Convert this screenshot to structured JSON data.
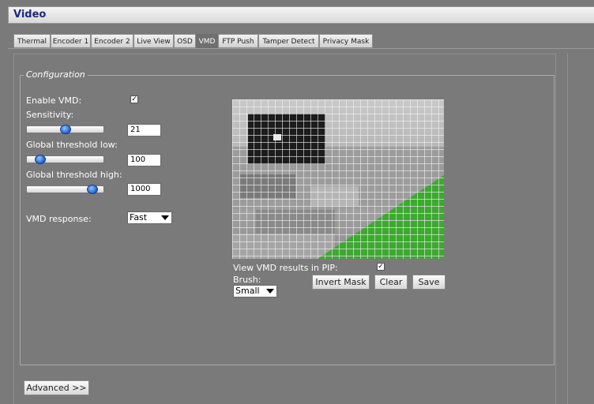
{
  "title": "Video",
  "tabs": [
    {
      "label": "Thermal",
      "active": false
    },
    {
      "label": "Encoder 1",
      "active": false
    },
    {
      "label": "Encoder 2",
      "active": false
    },
    {
      "label": "Live View",
      "active": false
    },
    {
      "label": "OSD",
      "active": false
    },
    {
      "label": "VMD",
      "active": true
    },
    {
      "label": "FTP Push",
      "active": false
    },
    {
      "label": "Tamper Detect",
      "active": false
    },
    {
      "label": "Privacy Mask",
      "active": false
    }
  ],
  "configuration": {
    "legend": "Configuration",
    "enable_vmd": {
      "label": "Enable VMD:",
      "checked": true
    },
    "sensitivity": {
      "label": "Sensitivity:",
      "value": "21",
      "slider_fraction": 0.5
    },
    "threshold_low": {
      "label": "Global threshold low:",
      "value": "100",
      "slider_fraction": 0.12
    },
    "threshold_high": {
      "label": "Global threshold high:",
      "value": "1000",
      "slider_fraction": 0.92
    },
    "vmd_response": {
      "label": "VMD response:",
      "selected": "Fast"
    }
  },
  "pip": {
    "label": "View VMD results in PIP:",
    "checked": true
  },
  "brush": {
    "label": "Brush:",
    "selected": "Small"
  },
  "buttons": {
    "invert_mask": "Invert Mask",
    "clear": "Clear",
    "save": "Save",
    "advanced": "Advanced >>"
  },
  "colors": {
    "background": "#7a7a7a",
    "title_text": "#1b2a7e",
    "mask_green": "#3ea832",
    "slider_knob": "#1f5fc8"
  }
}
